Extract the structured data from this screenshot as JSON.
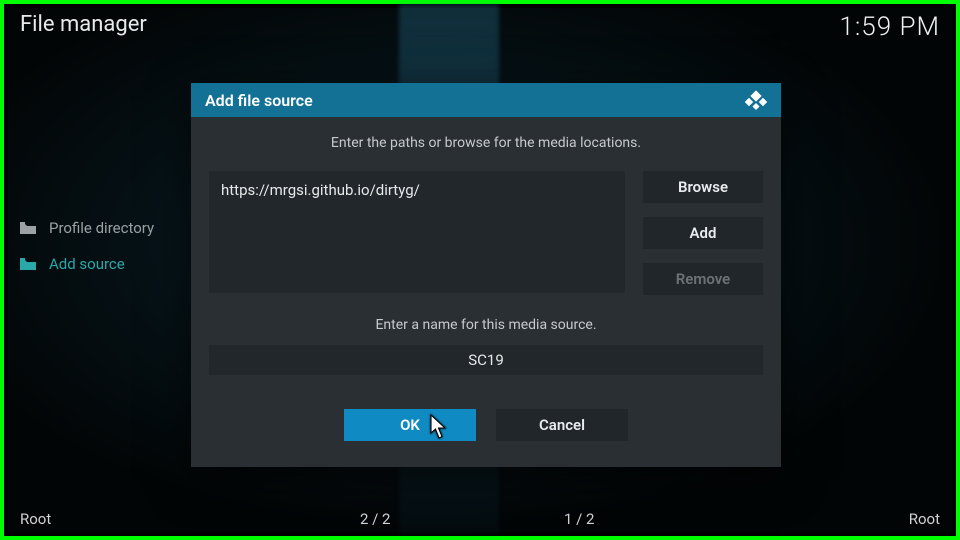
{
  "header": {
    "title": "File manager",
    "clock": "1:59 PM"
  },
  "sidebar": {
    "items": [
      {
        "label": "Profile directory",
        "accent": false
      },
      {
        "label": "Add source",
        "accent": true
      }
    ]
  },
  "dialog": {
    "title": "Add file source",
    "instruction": "Enter the paths or browse for the media locations.",
    "path_value": "https://mrgsi.github.io/dirtyg/",
    "side_buttons": {
      "browse": "Browse",
      "add": "Add",
      "remove": "Remove"
    },
    "name_label": "Enter a name for this media source.",
    "name_value": "SC19",
    "actions": {
      "ok": "OK",
      "cancel": "Cancel"
    }
  },
  "footer": {
    "left": "Root",
    "count_left": "2 / 2",
    "count_right": "1 / 2",
    "right": "Root"
  },
  "colors": {
    "accent": "#0f8ac2",
    "titlebar": "#127195",
    "teal": "#2aa7a7"
  }
}
